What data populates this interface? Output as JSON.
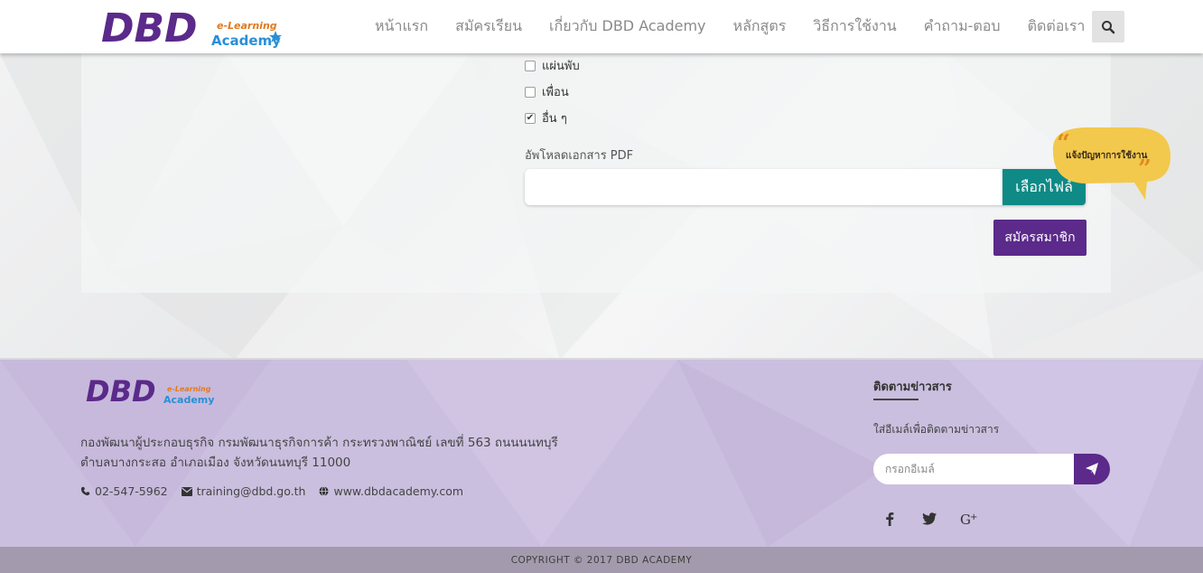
{
  "header": {
    "logo_brand": "DBD",
    "logo_sub1": "e-Learning",
    "logo_sub2": "Academy",
    "nav": [
      "หน้าแรก",
      "สมัครเรียน",
      "เกี่ยวกับ DBD Academy",
      "หลักสูตร",
      "วิธีการใช้งาน",
      "คำถาม-ตอบ",
      "ติดต่อเรา"
    ],
    "search_icon": "search-icon"
  },
  "form": {
    "checkboxes": [
      {
        "label": "แผ่นพับ",
        "checked": false
      },
      {
        "label": "เพื่อน",
        "checked": false
      },
      {
        "label": "อื่น ๆ",
        "checked": true
      }
    ],
    "upload_label": "อัพโหลดเอกสาร PDF",
    "file_value": "",
    "file_button": "เลือกไฟล์",
    "submit_button": "สมัครสมาชิก"
  },
  "footer": {
    "address_line1": "กองพัฒนาผู้ประกอบธุรกิจ กรมพัฒนาธุรกิจการค้า กระทรวงพาณิชย์ เลขที่ 563 ถนนนนทบุรี",
    "address_line2": "ตำบลบางกระสอ อำเภอเมือง จังหวัดนนทบุรี 11000",
    "phone": "02-547-5962",
    "email": "training@dbd.go.th",
    "website": "www.dbdacademy.com",
    "newsletter_title": "ติดตามข่าวสาร",
    "newsletter_sub": "ใส่อีเมล์เพื่อติดตามข่าวสาร",
    "email_placeholder": "กรอกอีเมล์",
    "social": [
      "facebook-icon",
      "twitter-icon",
      "google-plus-icon"
    ],
    "report_bubble": "แจ้งปัญหาการใช้งาน",
    "copyright": "COPYRIGHT © 2017 DBD ACADEMY"
  },
  "colors": {
    "purple": "#5b2a8a",
    "teal": "#0f8a86",
    "footer_bg": "#cbbfdf",
    "bubble": "#f2c94c"
  }
}
